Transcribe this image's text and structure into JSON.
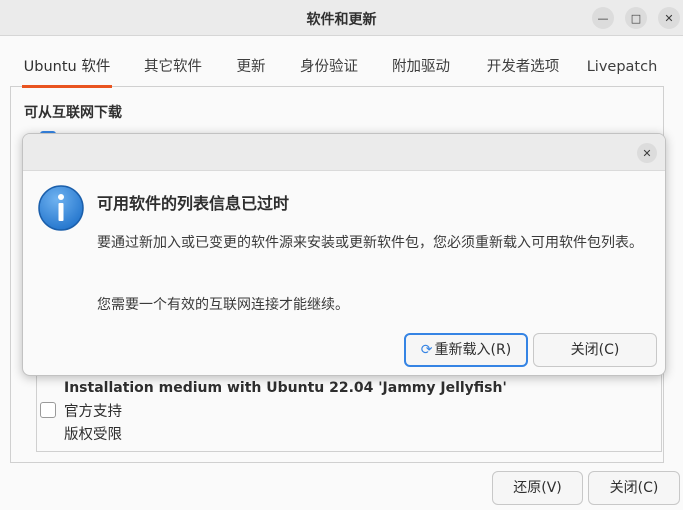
{
  "window": {
    "title": "软件和更新"
  },
  "tabs": [
    "Ubuntu 软件",
    "其它软件",
    "更新",
    "身份验证",
    "附加驱动",
    "开发者选项",
    "Livepatch"
  ],
  "main": {
    "section_title": "可从互联网下载",
    "media_title": "Installation medium with Ubuntu 22.04 'Jammy Jellyfish'",
    "media_line1": "官方支持",
    "media_line2": "版权受限"
  },
  "footer": {
    "revert_label": "还原(V)",
    "close_label": "关闭(C)"
  },
  "dialog": {
    "heading": "可用软件的列表信息已过时",
    "body": "要通过新加入或已变更的软件源来安装或更新软件包，您必须重新载入可用软件包列表。",
    "body2": "您需要一个有效的互联网连接才能继续。",
    "reload_label": "重新载入(R)",
    "close_label": "关闭(C)"
  },
  "colors": {
    "accent": "#e95420",
    "info_blue": "#3584e4"
  }
}
